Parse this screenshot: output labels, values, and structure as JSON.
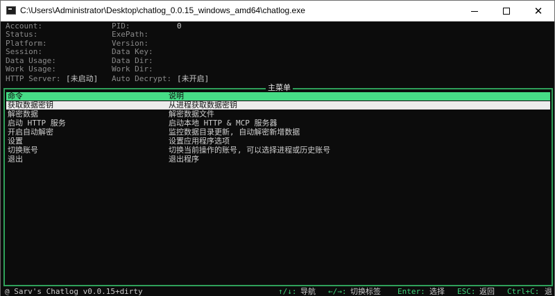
{
  "window": {
    "title": "C:\\Users\\Administrator\\Desktop\\chatlog_0.0.15_windows_amd64\\chatlog.exe",
    "controls": {
      "minimize": "—",
      "maximize": "☐",
      "close": "✕"
    }
  },
  "info": {
    "left": [
      {
        "label": "Account:",
        "value": ""
      },
      {
        "label": "Status:",
        "value": ""
      },
      {
        "label": "Platform:",
        "value": ""
      },
      {
        "label": "Session:",
        "value": ""
      },
      {
        "label": "Data Usage:",
        "value": ""
      },
      {
        "label": "Work Usage:",
        "value": ""
      },
      {
        "label": "HTTP Server:",
        "value": "[未启动]"
      }
    ],
    "right": [
      {
        "label": "PID:",
        "value": "0"
      },
      {
        "label": "ExePath:",
        "value": ""
      },
      {
        "label": "Version:",
        "value": ""
      },
      {
        "label": "Data Key:",
        "value": ""
      },
      {
        "label": "Data Dir:",
        "value": ""
      },
      {
        "label": "Work Dir:",
        "value": ""
      },
      {
        "label": "Auto Decrypt:",
        "value": "[未开启]"
      }
    ]
  },
  "menu": {
    "title": "主菜单",
    "header": {
      "command": "命令",
      "description": "说明"
    },
    "items": [
      {
        "command": "获取数据密钥",
        "description": "从进程获取数据密钥",
        "selected": true
      },
      {
        "command": "解密数据",
        "description": "解密数据文件"
      },
      {
        "command": "启动 HTTP 服务",
        "description": "启动本地 HTTP & MCP 服务器"
      },
      {
        "command": "开启自动解密",
        "description": "监控数据目录更新, 自动解密新增数据"
      },
      {
        "command": "设置",
        "description": "设置应用程序选项"
      },
      {
        "command": "切换账号",
        "description": "切换当前操作的账号, 可以选择进程或历史账号"
      },
      {
        "command": "退出",
        "description": "退出程序"
      }
    ]
  },
  "statusbar": {
    "left": "@ Sarv's Chatlog v0.0.15+dirty",
    "hints": [
      {
        "key": "↑/↓:",
        "text": "导航"
      },
      {
        "key": "←/→:",
        "text": "切换标签"
      },
      {
        "key": "Enter:",
        "text": "选择"
      },
      {
        "key": "ESC:",
        "text": "返回"
      },
      {
        "key": "Ctrl+C:",
        "text": "退"
      }
    ]
  },
  "colors": {
    "accent_green": "#46dc86",
    "border_green": "#2fa15a",
    "selected_row_bg": "#ececec",
    "terminal_bg": "#0c0c0c"
  }
}
